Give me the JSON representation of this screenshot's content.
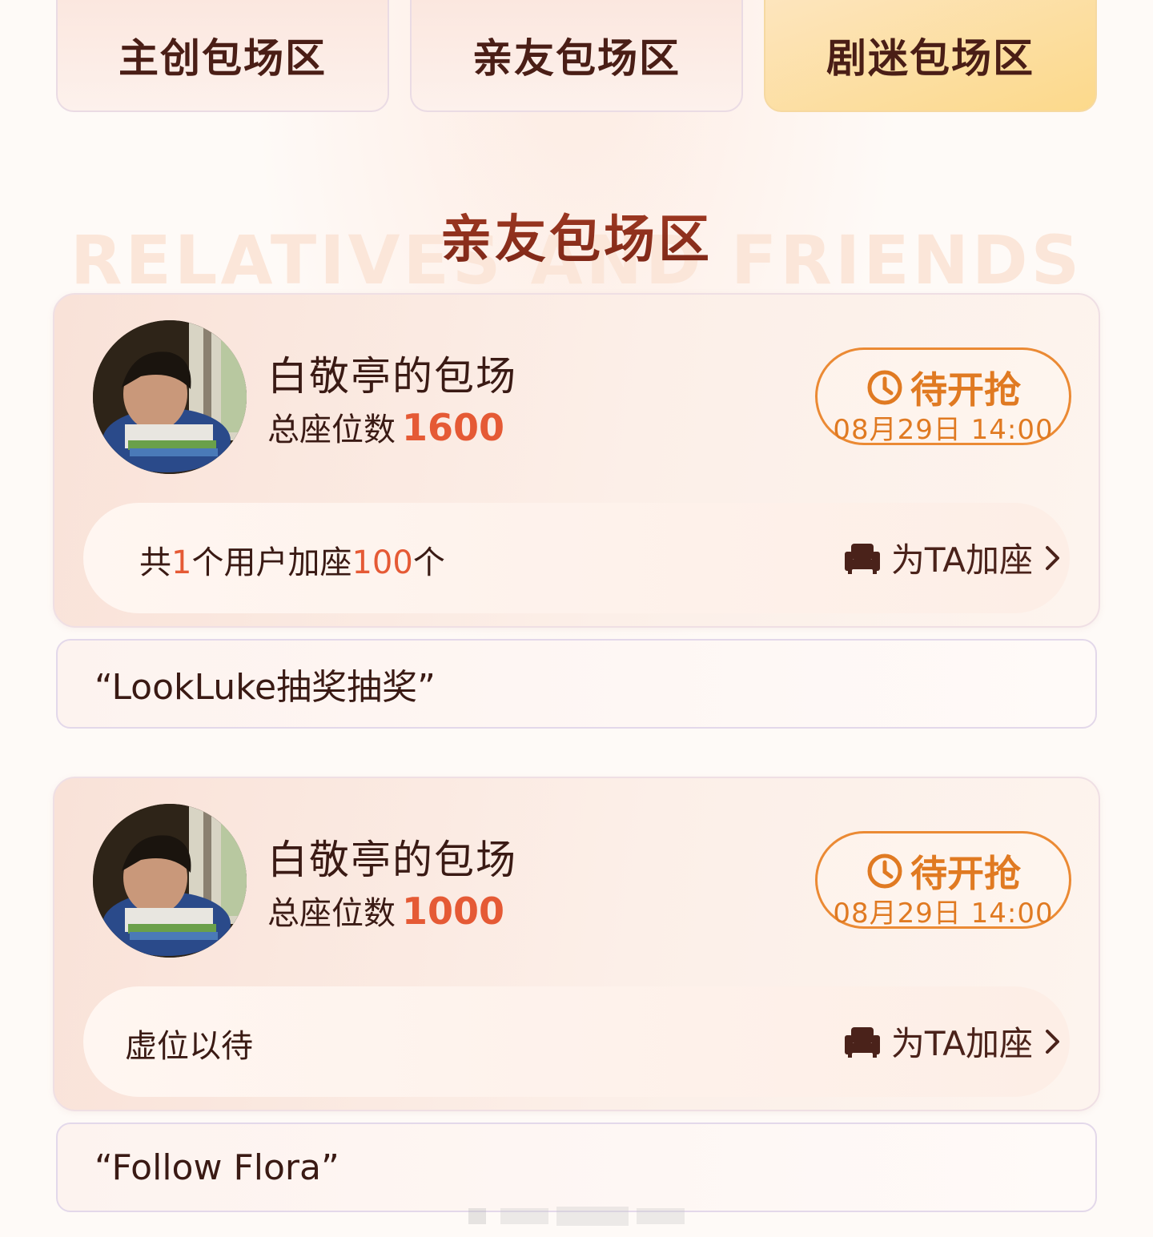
{
  "tabs": [
    {
      "label": "主创包场区",
      "active": false
    },
    {
      "label": "亲友包场区",
      "active": false
    },
    {
      "label": "剧迷包场区",
      "active": true
    }
  ],
  "section": {
    "title": "亲友包场区",
    "bg_text": "RELATIVES AND FRIENDS"
  },
  "cards": [
    {
      "title": "白敬亭的包场",
      "seat_label": "总座位数",
      "seat_count": "1600",
      "status": "待开抢",
      "status_time": "08月29日 14:00",
      "bottom_parts": [
        "共",
        "1",
        "个用户加座",
        "100",
        "个"
      ],
      "add_seat_label": "为TA加座",
      "message": "“LookLuke抽奖抽奖”"
    },
    {
      "title": "白敬亭的包场",
      "seat_label": "总座位数",
      "seat_count": "1000",
      "status": "待开抢",
      "status_time": "08月29日 14:00",
      "bottom_text": "虚位以待",
      "add_seat_label": "为TA加座",
      "message": "“Follow Flora”"
    }
  ],
  "icons": {
    "clock": "clock-icon",
    "seat": "sofa-icon",
    "chevron": "chevron-right-icon"
  },
  "colors": {
    "accent_orange": "#eb8a34",
    "seat_number": "#e55a35",
    "active_tab": "#fcd98b",
    "title_red": "#a43c24"
  }
}
